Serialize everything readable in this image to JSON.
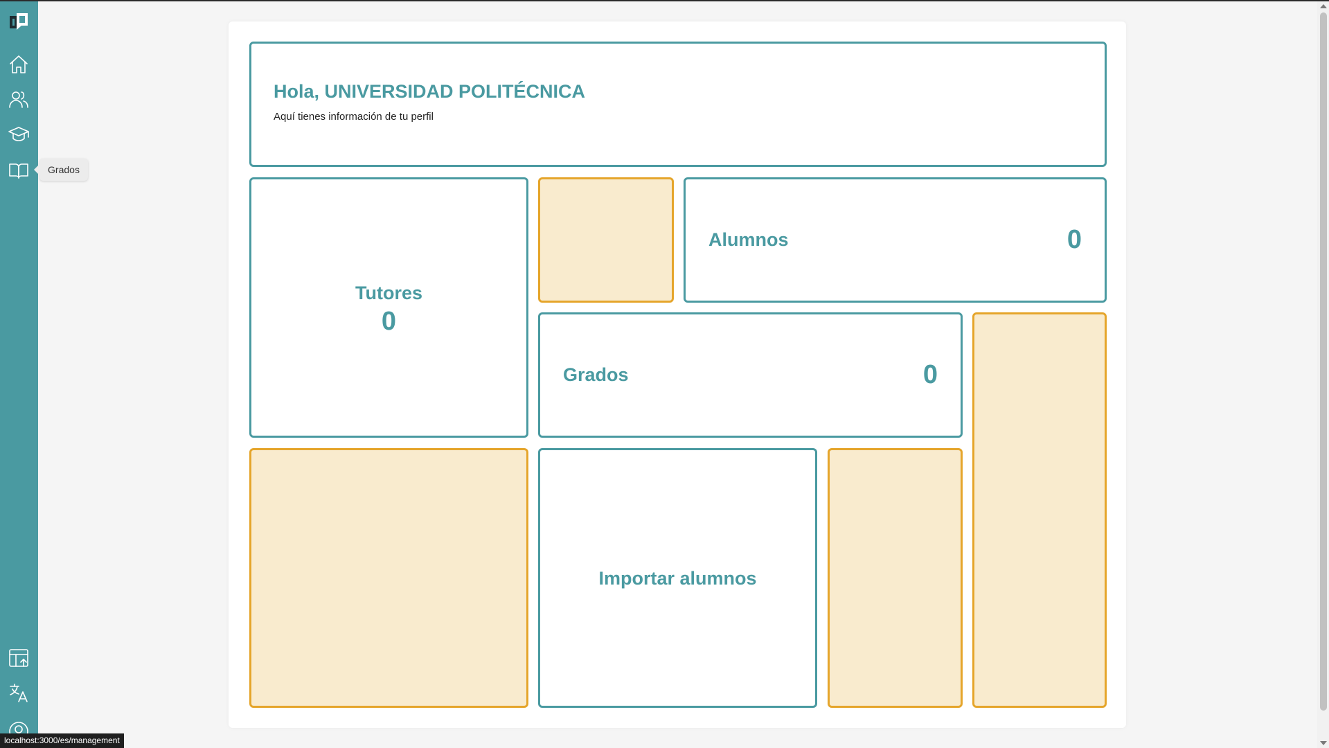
{
  "sidebar": {
    "logo_icon": "app-logo-icon",
    "items": [
      {
        "name": "home",
        "icon": "home-icon"
      },
      {
        "name": "users",
        "icon": "users-icon"
      },
      {
        "name": "graduation",
        "icon": "graduation-cap-icon"
      },
      {
        "name": "grados",
        "icon": "book-icon"
      }
    ],
    "bottom_items": [
      {
        "name": "import-table",
        "icon": "table-import-icon"
      },
      {
        "name": "language",
        "icon": "translate-icon"
      },
      {
        "name": "profile",
        "icon": "user-circle-icon"
      }
    ],
    "tooltip": "Grados"
  },
  "header": {
    "title": "Hola, UNIVERSIDAD POLITÉCNICA",
    "subtitle": "Aquí tienes información de tu perfil"
  },
  "cards": {
    "tutores": {
      "label": "Tutores",
      "value": "0"
    },
    "alumnos": {
      "label": "Alumnos",
      "value": "0"
    },
    "grados": {
      "label": "Grados",
      "value": "0"
    },
    "importar": {
      "label": "Importar alumnos"
    }
  },
  "status_bar": {
    "url": "localhost:3000/es/management"
  },
  "colors": {
    "accent": "#4a9aa1",
    "placeholder_border": "#e5a52b",
    "placeholder_fill": "#f9ebce"
  }
}
